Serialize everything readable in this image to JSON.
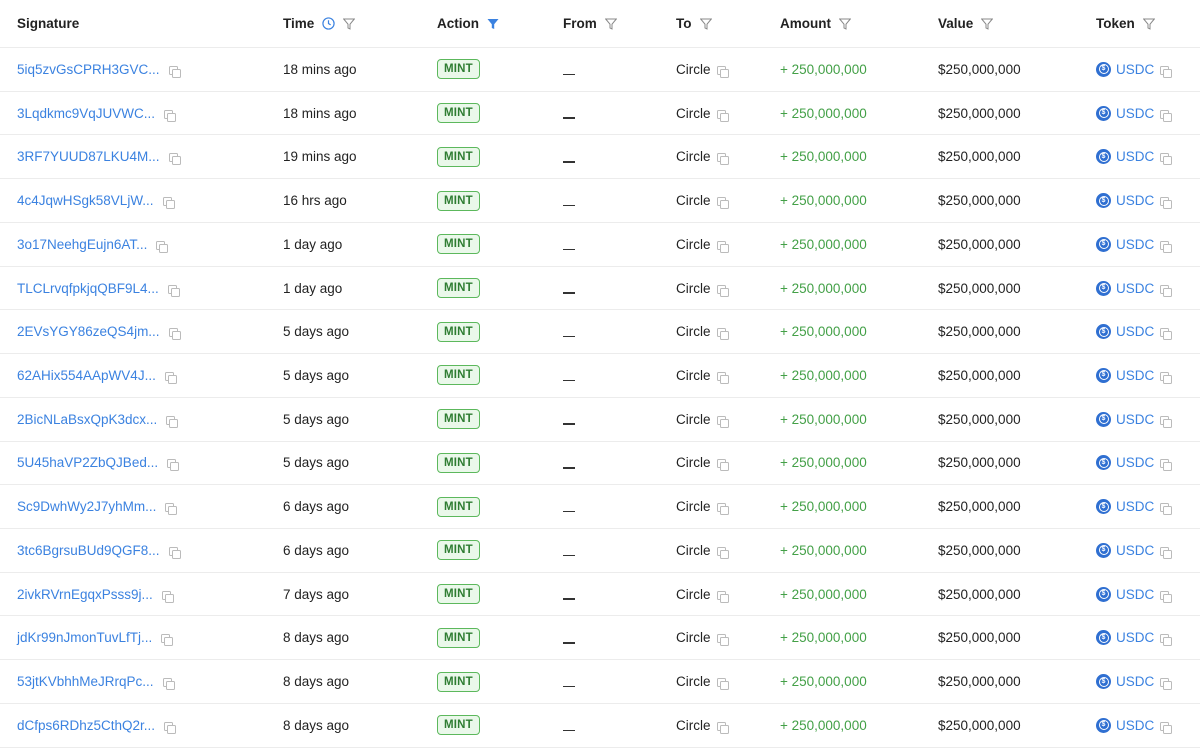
{
  "header": {
    "signature": "Signature",
    "time": "Time",
    "action": "Action",
    "from": "From",
    "to": "To",
    "amount": "Amount",
    "value": "Value",
    "token": "Token"
  },
  "colors": {
    "accent": "#3b82e0",
    "positive": "#43a047",
    "badge": "#2e7d32"
  },
  "rows": [
    {
      "signature": "5iq5zvGsCPRH3GVC...",
      "time": "18 mins ago",
      "action": "MINT",
      "from": "",
      "to": "Circle",
      "amount": "+ 250,000,000",
      "value": "$250,000,000",
      "token": "USDC"
    },
    {
      "signature": "3Lqdkmc9VqJUVWC...",
      "time": "18 mins ago",
      "action": "MINT",
      "from": "",
      "to": "Circle",
      "amount": "+ 250,000,000",
      "value": "$250,000,000",
      "token": "USDC"
    },
    {
      "signature": "3RF7YUUD87LKU4M...",
      "time": "19 mins ago",
      "action": "MINT",
      "from": "",
      "to": "Circle",
      "amount": "+ 250,000,000",
      "value": "$250,000,000",
      "token": "USDC"
    },
    {
      "signature": "4c4JqwHSgk58VLjW...",
      "time": "16 hrs ago",
      "action": "MINT",
      "from": "",
      "to": "Circle",
      "amount": "+ 250,000,000",
      "value": "$250,000,000",
      "token": "USDC"
    },
    {
      "signature": "3o17NeehgEujn6AT...",
      "time": "1 day ago",
      "action": "MINT",
      "from": "",
      "to": "Circle",
      "amount": "+ 250,000,000",
      "value": "$250,000,000",
      "token": "USDC"
    },
    {
      "signature": "TLCLrvqfpkjqQBF9L4...",
      "time": "1 day ago",
      "action": "MINT",
      "from": "",
      "to": "Circle",
      "amount": "+ 250,000,000",
      "value": "$250,000,000",
      "token": "USDC"
    },
    {
      "signature": "2EVsYGY86zeQS4jm...",
      "time": "5 days ago",
      "action": "MINT",
      "from": "",
      "to": "Circle",
      "amount": "+ 250,000,000",
      "value": "$250,000,000",
      "token": "USDC"
    },
    {
      "signature": "62AHix554AApWV4J...",
      "time": "5 days ago",
      "action": "MINT",
      "from": "",
      "to": "Circle",
      "amount": "+ 250,000,000",
      "value": "$250,000,000",
      "token": "USDC"
    },
    {
      "signature": "2BicNLaBsxQpK3dcx...",
      "time": "5 days ago",
      "action": "MINT",
      "from": "",
      "to": "Circle",
      "amount": "+ 250,000,000",
      "value": "$250,000,000",
      "token": "USDC"
    },
    {
      "signature": "5U45haVP2ZbQJBed...",
      "time": "5 days ago",
      "action": "MINT",
      "from": "",
      "to": "Circle",
      "amount": "+ 250,000,000",
      "value": "$250,000,000",
      "token": "USDC"
    },
    {
      "signature": "Sc9DwhWy2J7yhMm...",
      "time": "6 days ago",
      "action": "MINT",
      "from": "",
      "to": "Circle",
      "amount": "+ 250,000,000",
      "value": "$250,000,000",
      "token": "USDC"
    },
    {
      "signature": "3tc6BgrsuBUd9QGF8...",
      "time": "6 days ago",
      "action": "MINT",
      "from": "",
      "to": "Circle",
      "amount": "+ 250,000,000",
      "value": "$250,000,000",
      "token": "USDC"
    },
    {
      "signature": "2ivkRVrnEgqxPsss9j...",
      "time": "7 days ago",
      "action": "MINT",
      "from": "",
      "to": "Circle",
      "amount": "+ 250,000,000",
      "value": "$250,000,000",
      "token": "USDC"
    },
    {
      "signature": "jdKr99nJmonTuvLfTj...",
      "time": "8 days ago",
      "action": "MINT",
      "from": "",
      "to": "Circle",
      "amount": "+ 250,000,000",
      "value": "$250,000,000",
      "token": "USDC"
    },
    {
      "signature": "53jtKVbhhMeJRrqPc...",
      "time": "8 days ago",
      "action": "MINT",
      "from": "",
      "to": "Circle",
      "amount": "+ 250,000,000",
      "value": "$250,000,000",
      "token": "USDC"
    },
    {
      "signature": "dCfps6RDhz5CthQ2r...",
      "time": "8 days ago",
      "action": "MINT",
      "from": "",
      "to": "Circle",
      "amount": "+ 250,000,000",
      "value": "$250,000,000",
      "token": "USDC"
    }
  ]
}
